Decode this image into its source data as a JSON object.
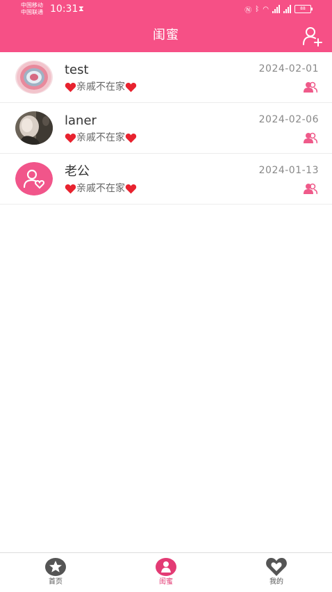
{
  "status_bar": {
    "carrier1": "中国移动",
    "carrier2": "中国联通",
    "time": "10:31",
    "battery": "88"
  },
  "header": {
    "title": "闺蜜"
  },
  "friends": [
    {
      "name": "test",
      "status": "亲戚不在家",
      "date": "2024-02-01",
      "avatar": "pink-ring"
    },
    {
      "name": "laner",
      "status": "亲戚不在家",
      "date": "2024-02-06",
      "avatar": "photo"
    },
    {
      "name": "老公",
      "status": "亲戚不在家",
      "date": "2024-01-13",
      "avatar": "default-user-heart"
    }
  ],
  "tabs": [
    {
      "label": "首页",
      "icon": "star-icon",
      "active": false
    },
    {
      "label": "闺蜜",
      "icon": "girl-icon",
      "active": true
    },
    {
      "label": "我的",
      "icon": "heart-icon",
      "active": false
    }
  ],
  "colors": {
    "brand": "#f65086",
    "heart": "#e8232f",
    "active_tab": "#e33b74",
    "inactive_tab": "#555555"
  }
}
